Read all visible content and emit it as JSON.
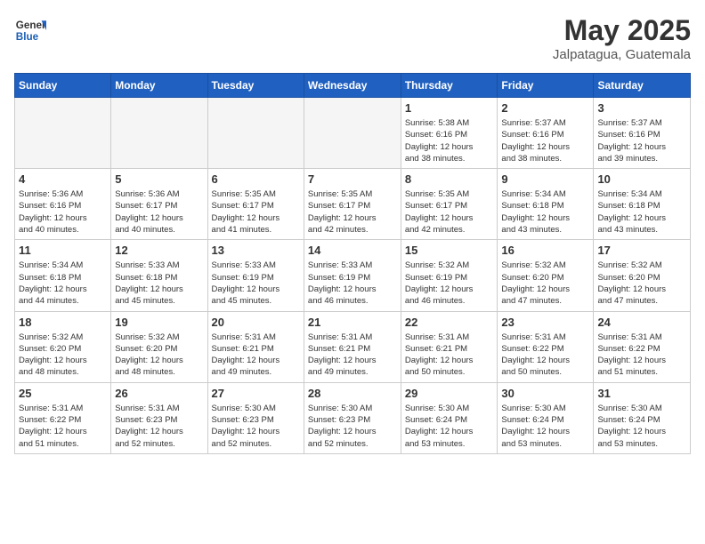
{
  "header": {
    "logo_general": "General",
    "logo_blue": "Blue",
    "month_title": "May 2025",
    "location": "Jalpatagua, Guatemala"
  },
  "weekdays": [
    "Sunday",
    "Monday",
    "Tuesday",
    "Wednesday",
    "Thursday",
    "Friday",
    "Saturday"
  ],
  "weeks": [
    [
      {
        "day": "",
        "info": ""
      },
      {
        "day": "",
        "info": ""
      },
      {
        "day": "",
        "info": ""
      },
      {
        "day": "",
        "info": ""
      },
      {
        "day": "1",
        "info": "Sunrise: 5:38 AM\nSunset: 6:16 PM\nDaylight: 12 hours\nand 38 minutes."
      },
      {
        "day": "2",
        "info": "Sunrise: 5:37 AM\nSunset: 6:16 PM\nDaylight: 12 hours\nand 38 minutes."
      },
      {
        "day": "3",
        "info": "Sunrise: 5:37 AM\nSunset: 6:16 PM\nDaylight: 12 hours\nand 39 minutes."
      }
    ],
    [
      {
        "day": "4",
        "info": "Sunrise: 5:36 AM\nSunset: 6:16 PM\nDaylight: 12 hours\nand 40 minutes."
      },
      {
        "day": "5",
        "info": "Sunrise: 5:36 AM\nSunset: 6:17 PM\nDaylight: 12 hours\nand 40 minutes."
      },
      {
        "day": "6",
        "info": "Sunrise: 5:35 AM\nSunset: 6:17 PM\nDaylight: 12 hours\nand 41 minutes."
      },
      {
        "day": "7",
        "info": "Sunrise: 5:35 AM\nSunset: 6:17 PM\nDaylight: 12 hours\nand 42 minutes."
      },
      {
        "day": "8",
        "info": "Sunrise: 5:35 AM\nSunset: 6:17 PM\nDaylight: 12 hours\nand 42 minutes."
      },
      {
        "day": "9",
        "info": "Sunrise: 5:34 AM\nSunset: 6:18 PM\nDaylight: 12 hours\nand 43 minutes."
      },
      {
        "day": "10",
        "info": "Sunrise: 5:34 AM\nSunset: 6:18 PM\nDaylight: 12 hours\nand 43 minutes."
      }
    ],
    [
      {
        "day": "11",
        "info": "Sunrise: 5:34 AM\nSunset: 6:18 PM\nDaylight: 12 hours\nand 44 minutes."
      },
      {
        "day": "12",
        "info": "Sunrise: 5:33 AM\nSunset: 6:18 PM\nDaylight: 12 hours\nand 45 minutes."
      },
      {
        "day": "13",
        "info": "Sunrise: 5:33 AM\nSunset: 6:19 PM\nDaylight: 12 hours\nand 45 minutes."
      },
      {
        "day": "14",
        "info": "Sunrise: 5:33 AM\nSunset: 6:19 PM\nDaylight: 12 hours\nand 46 minutes."
      },
      {
        "day": "15",
        "info": "Sunrise: 5:32 AM\nSunset: 6:19 PM\nDaylight: 12 hours\nand 46 minutes."
      },
      {
        "day": "16",
        "info": "Sunrise: 5:32 AM\nSunset: 6:20 PM\nDaylight: 12 hours\nand 47 minutes."
      },
      {
        "day": "17",
        "info": "Sunrise: 5:32 AM\nSunset: 6:20 PM\nDaylight: 12 hours\nand 47 minutes."
      }
    ],
    [
      {
        "day": "18",
        "info": "Sunrise: 5:32 AM\nSunset: 6:20 PM\nDaylight: 12 hours\nand 48 minutes."
      },
      {
        "day": "19",
        "info": "Sunrise: 5:32 AM\nSunset: 6:20 PM\nDaylight: 12 hours\nand 48 minutes."
      },
      {
        "day": "20",
        "info": "Sunrise: 5:31 AM\nSunset: 6:21 PM\nDaylight: 12 hours\nand 49 minutes."
      },
      {
        "day": "21",
        "info": "Sunrise: 5:31 AM\nSunset: 6:21 PM\nDaylight: 12 hours\nand 49 minutes."
      },
      {
        "day": "22",
        "info": "Sunrise: 5:31 AM\nSunset: 6:21 PM\nDaylight: 12 hours\nand 50 minutes."
      },
      {
        "day": "23",
        "info": "Sunrise: 5:31 AM\nSunset: 6:22 PM\nDaylight: 12 hours\nand 50 minutes."
      },
      {
        "day": "24",
        "info": "Sunrise: 5:31 AM\nSunset: 6:22 PM\nDaylight: 12 hours\nand 51 minutes."
      }
    ],
    [
      {
        "day": "25",
        "info": "Sunrise: 5:31 AM\nSunset: 6:22 PM\nDaylight: 12 hours\nand 51 minutes."
      },
      {
        "day": "26",
        "info": "Sunrise: 5:31 AM\nSunset: 6:23 PM\nDaylight: 12 hours\nand 52 minutes."
      },
      {
        "day": "27",
        "info": "Sunrise: 5:30 AM\nSunset: 6:23 PM\nDaylight: 12 hours\nand 52 minutes."
      },
      {
        "day": "28",
        "info": "Sunrise: 5:30 AM\nSunset: 6:23 PM\nDaylight: 12 hours\nand 52 minutes."
      },
      {
        "day": "29",
        "info": "Sunrise: 5:30 AM\nSunset: 6:24 PM\nDaylight: 12 hours\nand 53 minutes."
      },
      {
        "day": "30",
        "info": "Sunrise: 5:30 AM\nSunset: 6:24 PM\nDaylight: 12 hours\nand 53 minutes."
      },
      {
        "day": "31",
        "info": "Sunrise: 5:30 AM\nSunset: 6:24 PM\nDaylight: 12 hours\nand 53 minutes."
      }
    ]
  ]
}
